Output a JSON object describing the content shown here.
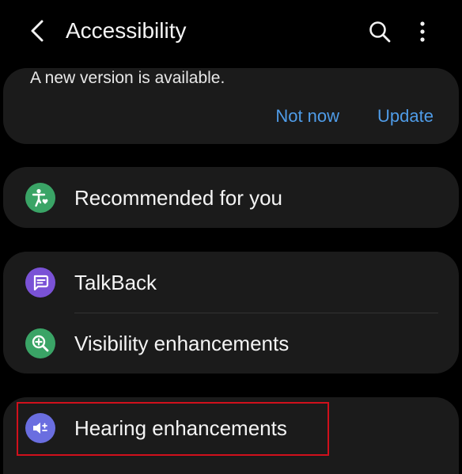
{
  "header": {
    "title": "Accessibility",
    "back_icon": "chevron-left-icon",
    "search_icon": "search-icon",
    "more_icon": "more-vertical-icon"
  },
  "update_banner": {
    "message": "A new version is available.",
    "not_now_label": "Not now",
    "update_label": "Update",
    "action_color": "#4f9ce8"
  },
  "menu": {
    "recommended": {
      "label": "Recommended for you",
      "icon": "accessibility-person-icon",
      "icon_color": "#3aa466"
    },
    "talkback": {
      "label": "TalkBack",
      "icon": "chat-bubble-icon",
      "icon_color": "#7a52d6"
    },
    "visibility": {
      "label": "Visibility enhancements",
      "icon": "zoom-plus-icon",
      "icon_color": "#3aa466"
    },
    "hearing": {
      "label": "Hearing enhancements",
      "icon": "speaker-plus-minus-icon",
      "icon_color": "#6a6ee0"
    }
  },
  "colors": {
    "background": "#000000",
    "card": "#1b1b1b",
    "highlight": "#d0101c"
  }
}
